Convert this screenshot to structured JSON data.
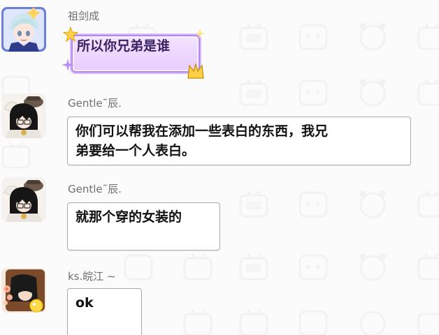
{
  "messages": [
    {
      "sender": "祖剑成",
      "text": "所以你兄弟是谁",
      "style": "fancy-purple",
      "avatar_icon": "anime-avatar-silver-hair-icon"
    },
    {
      "sender": "Gentle˜辰.",
      "text_lines": [
        "你们可以帮我在添加一些表白的东西，我兄",
        "弟要给一个人表白。"
      ],
      "style": "plain",
      "avatar_icon": "anime-avatar-dark-hair-hat-icon"
    },
    {
      "sender": "Gentle˜辰.",
      "text": "就那个穿的女装的",
      "style": "plain",
      "avatar_icon": "anime-avatar-dark-hair-hat-icon"
    },
    {
      "sender": "ks.皖江 ~",
      "text": "ok",
      "style": "plain",
      "avatar_icon": "avatar-dark-hair-flowers-icon"
    }
  ],
  "colors": {
    "background": "#fbfbfb",
    "bubble_border": "#a9a9a9",
    "name_text": "#6f6f6f",
    "fancy_bubble": "#e8ccff",
    "fancy_border": "#b38ae8"
  },
  "background_pattern_icon": "bilibili-tv-watermark-icon"
}
